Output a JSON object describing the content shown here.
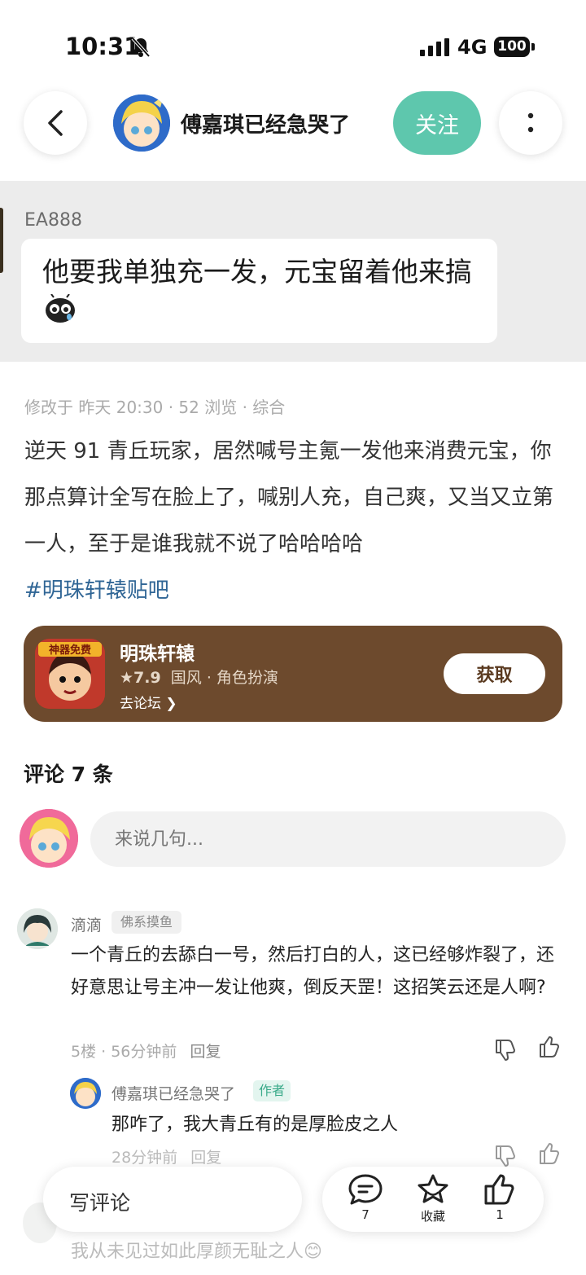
{
  "status_bar": {
    "time": "10:31",
    "network": "4G",
    "battery": "100"
  },
  "header": {
    "username": "傅嘉琪已经急哭了",
    "follow_label": "关注"
  },
  "quote": {
    "user": "EA888",
    "text": "他要我单独充一发，元宝留着他来搞"
  },
  "post": {
    "meta": "修改于 昨天 20:30 · 52 浏览 · 综合",
    "body": "逆天 91 青丘玩家，居然喊号主氪一发他来消费元宝，你那点算计全写在脸上了，喊别人充，自己爽，又当又立第一人，至于是谁我就不说了哈哈哈哈",
    "hashtag": "#明珠轩辕贴吧"
  },
  "game_card": {
    "name": "明珠轩辕",
    "rating": "★7.9",
    "genres": "国风 · 角色扮演",
    "forum_link": "去论坛 ❯",
    "get_label": "获取",
    "icon_badge": "神器免费"
  },
  "comments": {
    "title": "评论 7 条",
    "input_placeholder": "来说几句...",
    "items": [
      {
        "name": "滴滴",
        "tag": "佛系摸鱼",
        "text": "一个青丘的去舔白一号，然后打白的人，这已经够炸裂了，还好意思让号主冲一发让他爽，倒反天罡！这招笑云还是人啊?",
        "meta": "5楼 · 56分钟前",
        "reply_label": "回复"
      }
    ],
    "reply": {
      "name": "傅嘉琪已经急哭了",
      "tag": "作者",
      "text": "那咋了，我大青丘有的是厚脸皮之人",
      "meta": "28分钟前",
      "reply_label": "回复"
    },
    "next_text": "我从未见过如此厚颜无耻之人😊"
  },
  "bottom_bar": {
    "write_label": "写评论",
    "comment_count": "7",
    "favorite_label": "收藏",
    "like_count": "1"
  },
  "colors": {
    "accent": "#5ec7ad",
    "card_bg": "#6d4a2d",
    "hashtag": "#2f6595"
  }
}
